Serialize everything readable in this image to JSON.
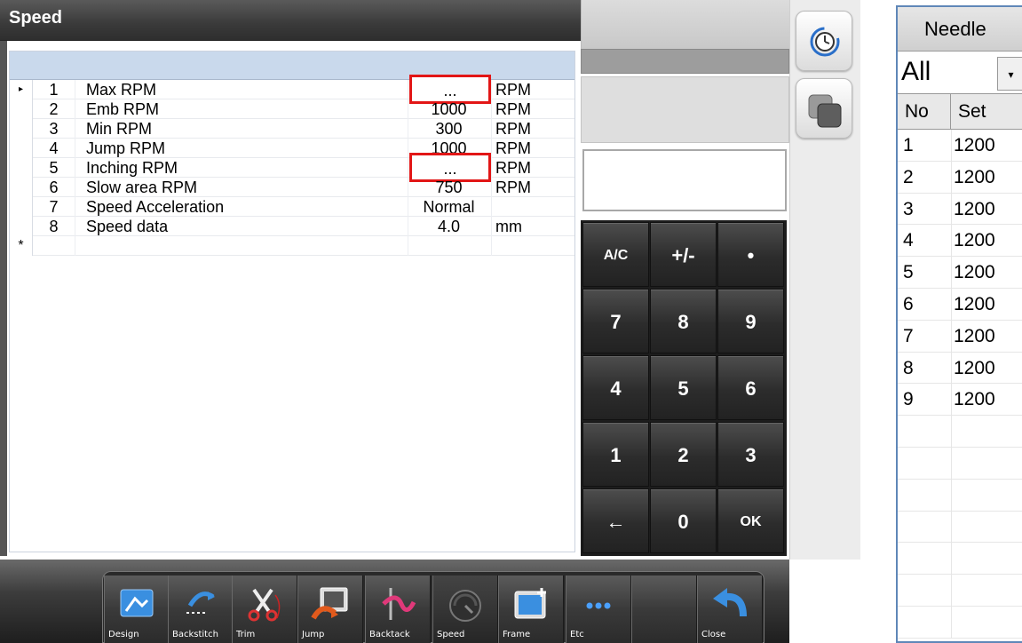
{
  "window": {
    "title": "Speed"
  },
  "speed_grid": {
    "row_pointer": "▸",
    "new_row_marker": "*",
    "rows": [
      {
        "no": "1",
        "name": "Max RPM",
        "value": "...",
        "unit": "RPM"
      },
      {
        "no": "2",
        "name": "Emb RPM",
        "value": "1000",
        "unit": "RPM"
      },
      {
        "no": "3",
        "name": "Min RPM",
        "value": "300",
        "unit": "RPM"
      },
      {
        "no": "4",
        "name": "Jump RPM",
        "value": "1000",
        "unit": "RPM"
      },
      {
        "no": "5",
        "name": "Inching RPM",
        "value": "...",
        "unit": "RPM"
      },
      {
        "no": "6",
        "name": "Slow area RPM",
        "value": "750",
        "unit": "RPM"
      },
      {
        "no": "7",
        "name": "Speed Acceleration",
        "value": "Normal",
        "unit": ""
      },
      {
        "no": "8",
        "name": "Speed data",
        "value": "4.0",
        "unit": "mm"
      }
    ],
    "highlight_color": "#e21616"
  },
  "keypad": {
    "keys": [
      "A/C",
      "+/-",
      "•",
      "7",
      "8",
      "9",
      "4",
      "5",
      "6",
      "1",
      "2",
      "3",
      "←",
      "0",
      "OK"
    ]
  },
  "rail": {
    "icons": [
      "clock-refresh-icon",
      "window-switch-icon"
    ]
  },
  "toolbar": {
    "design": "Design",
    "backstitch": "Backstitch",
    "trim": "Trim",
    "jump": "Jump",
    "backtack": "Backtack",
    "speed": "Speed",
    "frame": "Frame",
    "etc": "Etc",
    "close": "Close"
  },
  "needle_panel": {
    "title": "Needle",
    "filter_value": "All",
    "dropdown_icon": "▾",
    "col_no": "No",
    "col_set": "Set",
    "rows": [
      {
        "no": "1",
        "set": "1200"
      },
      {
        "no": "2",
        "set": "1200"
      },
      {
        "no": "3",
        "set": "1200"
      },
      {
        "no": "4",
        "set": "1200"
      },
      {
        "no": "5",
        "set": "1200"
      },
      {
        "no": "6",
        "set": "1200"
      },
      {
        "no": "7",
        "set": "1200"
      },
      {
        "no": "8",
        "set": "1200"
      },
      {
        "no": "9",
        "set": "1200"
      }
    ]
  }
}
